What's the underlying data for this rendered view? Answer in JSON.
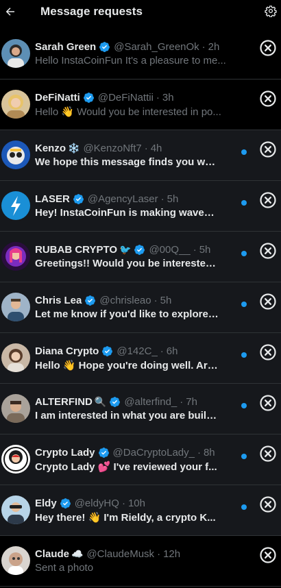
{
  "header": {
    "title": "Message requests",
    "back_icon": "arrow-left-icon",
    "settings_icon": "gear-icon"
  },
  "colors": {
    "accent": "#1d9bf0",
    "muted": "#71767b",
    "text": "#e7e9ea",
    "unread_bg": "#16181c",
    "divider": "#2f3336"
  },
  "requests": [
    {
      "name": "Sarah Green",
      "emoji": "",
      "verified": true,
      "handle": "@Sarah_GreenOk",
      "time": "2h",
      "preview": "Hello InstaCoinFun It's a pleasure to me...",
      "unread": false
    },
    {
      "name": "DeFiNatti",
      "emoji": "",
      "verified": true,
      "handle": "@DeFiNattii",
      "time": "3h",
      "preview": "Hello 👋 Would you be interested in po...",
      "unread": false
    },
    {
      "name": "Kenzo",
      "emoji": "❄️",
      "verified": false,
      "handle": "@KenzoNft7",
      "time": "4h",
      "preview": "We hope this message finds you wel...",
      "unread": true
    },
    {
      "name": "LASER",
      "emoji": "",
      "verified": true,
      "handle": "@AgencyLaser",
      "time": "5h",
      "preview": "Hey! InstaCoinFun is making waves. ...",
      "unread": true
    },
    {
      "name": "RUBAB CRYPTO",
      "emoji": "🐦",
      "verified": true,
      "handle": "@00Q__",
      "time": "5h",
      "preview": "Greetings!! Would you be interested ...",
      "unread": true
    },
    {
      "name": "Chris Lea",
      "emoji": "",
      "verified": true,
      "handle": "@chrisleao",
      "time": "5h",
      "preview": "Let me know if you'd like to explore t...",
      "unread": true
    },
    {
      "name": "Diana Crypto",
      "emoji": "",
      "verified": true,
      "handle": "@142C_",
      "time": "6h",
      "preview": "Hello 👋 Hope you're doing well. Are...",
      "unread": true
    },
    {
      "name": "ALTERFIND",
      "emoji": "🔍",
      "verified": true,
      "handle": "@alterfind_",
      "time": "7h",
      "preview": "I am interested in what you are build...",
      "unread": true
    },
    {
      "name": "Crypto Lady",
      "emoji": "",
      "verified": true,
      "handle": "@DaCryptoLady_",
      "time": "8h",
      "preview": "Crypto Lady 💕 I've reviewed your f...",
      "unread": true
    },
    {
      "name": "Eldy",
      "emoji": "",
      "verified": true,
      "handle": "@eldyHQ",
      "time": "10h",
      "preview": "Hey there! 👋 I'm Rieldy, a crypto K...",
      "unread": true
    },
    {
      "name": "Claude",
      "emoji": "☁️",
      "verified": false,
      "handle": "@ClaudeMusk",
      "time": "12h",
      "preview": "Sent a photo",
      "unread": false
    }
  ]
}
